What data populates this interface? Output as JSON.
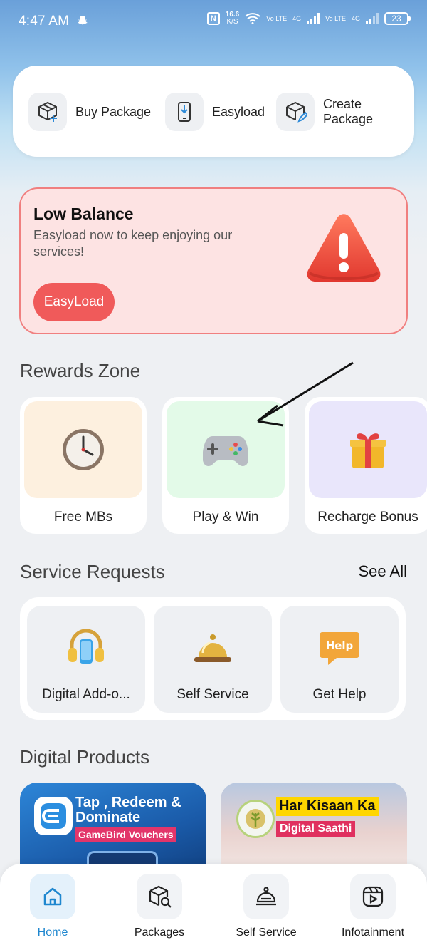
{
  "status_bar": {
    "time": "4:47 AM",
    "speed_value": "16.6",
    "speed_unit": "K/S",
    "net1": "4G",
    "net2": "4G",
    "volte1": "Vo LTE",
    "volte2": "Vo LTE",
    "battery": "23"
  },
  "quick_actions": [
    {
      "label": "Buy Package",
      "icon": "box-plus-icon"
    },
    {
      "label": "Easyload",
      "icon": "phone-download-icon"
    },
    {
      "label": "Create Package",
      "icon": "box-edit-icon"
    }
  ],
  "low_balance": {
    "title": "Low Balance",
    "text": "Easyload now to keep enjoying our services!",
    "button": "EasyLoad",
    "icon": "warning-triangle-icon"
  },
  "rewards": {
    "title": "Rewards Zone",
    "items": [
      {
        "label": "Free MBs",
        "icon": "clock-icon",
        "bg": "#fdf0df"
      },
      {
        "label": "Play & Win",
        "icon": "gamepad-icon",
        "bg": "#e3fae8"
      },
      {
        "label": "Recharge Bonus",
        "icon": "gift-icon",
        "bg": "#e9e6fb"
      }
    ]
  },
  "services": {
    "title": "Service Requests",
    "see_all": "See All",
    "items": [
      {
        "label": "Digital Add-o...",
        "icon": "headphones-icon"
      },
      {
        "label": "Self Service",
        "icon": "service-bell-icon"
      },
      {
        "label": "Get Help",
        "icon": "help-bubble-icon"
      }
    ]
  },
  "digital_products": {
    "title": "Digital Products",
    "cards": [
      {
        "headline": "Tap , Redeem & Dominate",
        "tag": "GameBird Vouchers"
      },
      {
        "headline": "Har Kisaan Ka",
        "tag": "Digital Saathi"
      }
    ]
  },
  "bottom_nav": [
    {
      "label": "Home",
      "icon": "home-icon"
    },
    {
      "label": "Packages",
      "icon": "package-search-icon"
    },
    {
      "label": "Self Service",
      "icon": "bell-service-icon"
    },
    {
      "label": "Infotainment",
      "icon": "play-reel-icon"
    }
  ],
  "colors": {
    "accent": "#1f87cf",
    "alert": "#f05a5a"
  }
}
